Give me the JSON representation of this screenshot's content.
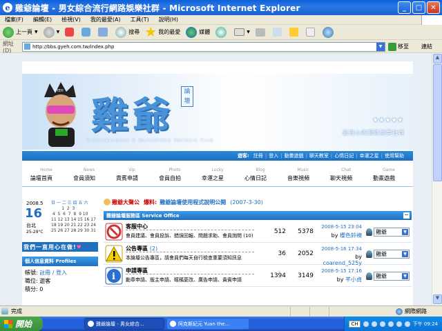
{
  "window": {
    "title": "雞爺論壇 - 男女綜合流行網路娛樂社群 - Microsoft Internet Explorer",
    "minimize": "_",
    "maximize": "□",
    "close": "✕"
  },
  "menubar": [
    "檔案(F)",
    "編輯(E)",
    "檢視(V)",
    "我的最愛(A)",
    "工具(T)",
    "說明(H)"
  ],
  "toolbar": {
    "back": "上一頁",
    "search": "搜尋",
    "favorites": "我的最愛",
    "media": "媒體"
  },
  "address": {
    "label": "網址(D)",
    "url": "http://bbs.gyeh.com.tw/index.php",
    "go": "移至",
    "links": "連結"
  },
  "site": {
    "logo_cn": "雞爺",
    "logo_small": "論壇",
    "logo_en": "Entertainment & Multimedia Network Club",
    "mascot_tag": "GYEH",
    "stars": "★★★★★",
    "slogan": "最用心的網路娛樂社群",
    "navstrip": {
      "guest": "遊客:",
      "items": [
        "註冊",
        "登入",
        "動畫遊戲",
        "聊天教室",
        "心情日記",
        "幸運之星",
        "使用幫助"
      ]
    },
    "menu": [
      {
        "en": "Home",
        "cn": "論壇首頁"
      },
      {
        "en": "News",
        "cn": "會員須知"
      },
      {
        "en": "Vip",
        "cn": "貴賓申請"
      },
      {
        "en": "Photo",
        "cn": "會員自拍"
      },
      {
        "en": "Lucky",
        "cn": "幸運之星"
      },
      {
        "en": "Blog",
        "cn": "心情日記"
      },
      {
        "en": "Music",
        "cn": "音樂視頻"
      },
      {
        "en": "Chat",
        "cn": "聊天視頻"
      },
      {
        "en": "Game",
        "cn": "動畫遊戲"
      }
    ],
    "calendar": {
      "year_month": "2008.5",
      "day": "16",
      "city": "台北",
      "weather": "25-29°C",
      "weekdays": "日 一 二 三 四 五 六",
      "weeks": [
        "        1  2  3",
        " 4  5  6  7  8  9 10",
        "11 12 13 14 15 16 17",
        "18 19 20 21 22 23 24",
        "25 26 27 28 29 30 31"
      ]
    },
    "love_banner": "我們一直用心在做!",
    "profile": {
      "title": "個人信息資料 Profiles",
      "rows": [
        {
          "label": "帳號:",
          "value": "註冊 / 登入"
        },
        {
          "label": "職位:",
          "value": "遊客"
        },
        {
          "label": "積分:",
          "value": "0"
        }
      ]
    },
    "announcement": {
      "label": "雞爺大聲公",
      "tag": "爆料:",
      "text": "雞爺論壇使用程式說明公開",
      "date": "(2007-3-30)"
    },
    "forum_group": {
      "title": "雞爺論壇服務區 Service Office",
      "forums": [
        {
          "name": "客服中心",
          "count": "",
          "desc": "會員建議、會員投訴、錯誤回報、問題求助、會員詢問",
          "desc_count": "(10)",
          "topics": "512",
          "posts": "5378",
          "last_time": "2008-5-15 23:04",
          "by": "by",
          "last_user": "櫻色鈴襖",
          "moderator": "雞爺"
        },
        {
          "name": "公告專區",
          "count": "(2)",
          "desc": "本論壇公告專區，請會員們每天自行檢查重要須知訊息",
          "desc_count": "",
          "topics": "36",
          "posts": "2052",
          "last_time": "2008-5-16 17:34",
          "by": "by",
          "last_user": "coarend_525y",
          "moderator": "雞爺"
        },
        {
          "name": "申請專區",
          "count": "",
          "desc": "勳章申請、版主申請、暱稱更改、廣告申請、貴賓申請",
          "desc_count": "",
          "topics": "1394",
          "posts": "3149",
          "last_time": "2008-5-15 17:16",
          "by": "by",
          "last_user": "芊小貞",
          "moderator": "雞爺"
        }
      ]
    }
  },
  "status": {
    "done": "完成",
    "zone": "網際網路"
  },
  "taskbar": {
    "start": "開始",
    "tasks": [
      "雞爺論壇 - 男女綜合...",
      "阿克斯紀元 Yuan the..."
    ],
    "lang": "CH",
    "clock": "下午 09:24"
  },
  "colors": {
    "accent": "#1e6fc0",
    "titlebar": "#2b78e4",
    "announce_red": "#cc0000"
  }
}
